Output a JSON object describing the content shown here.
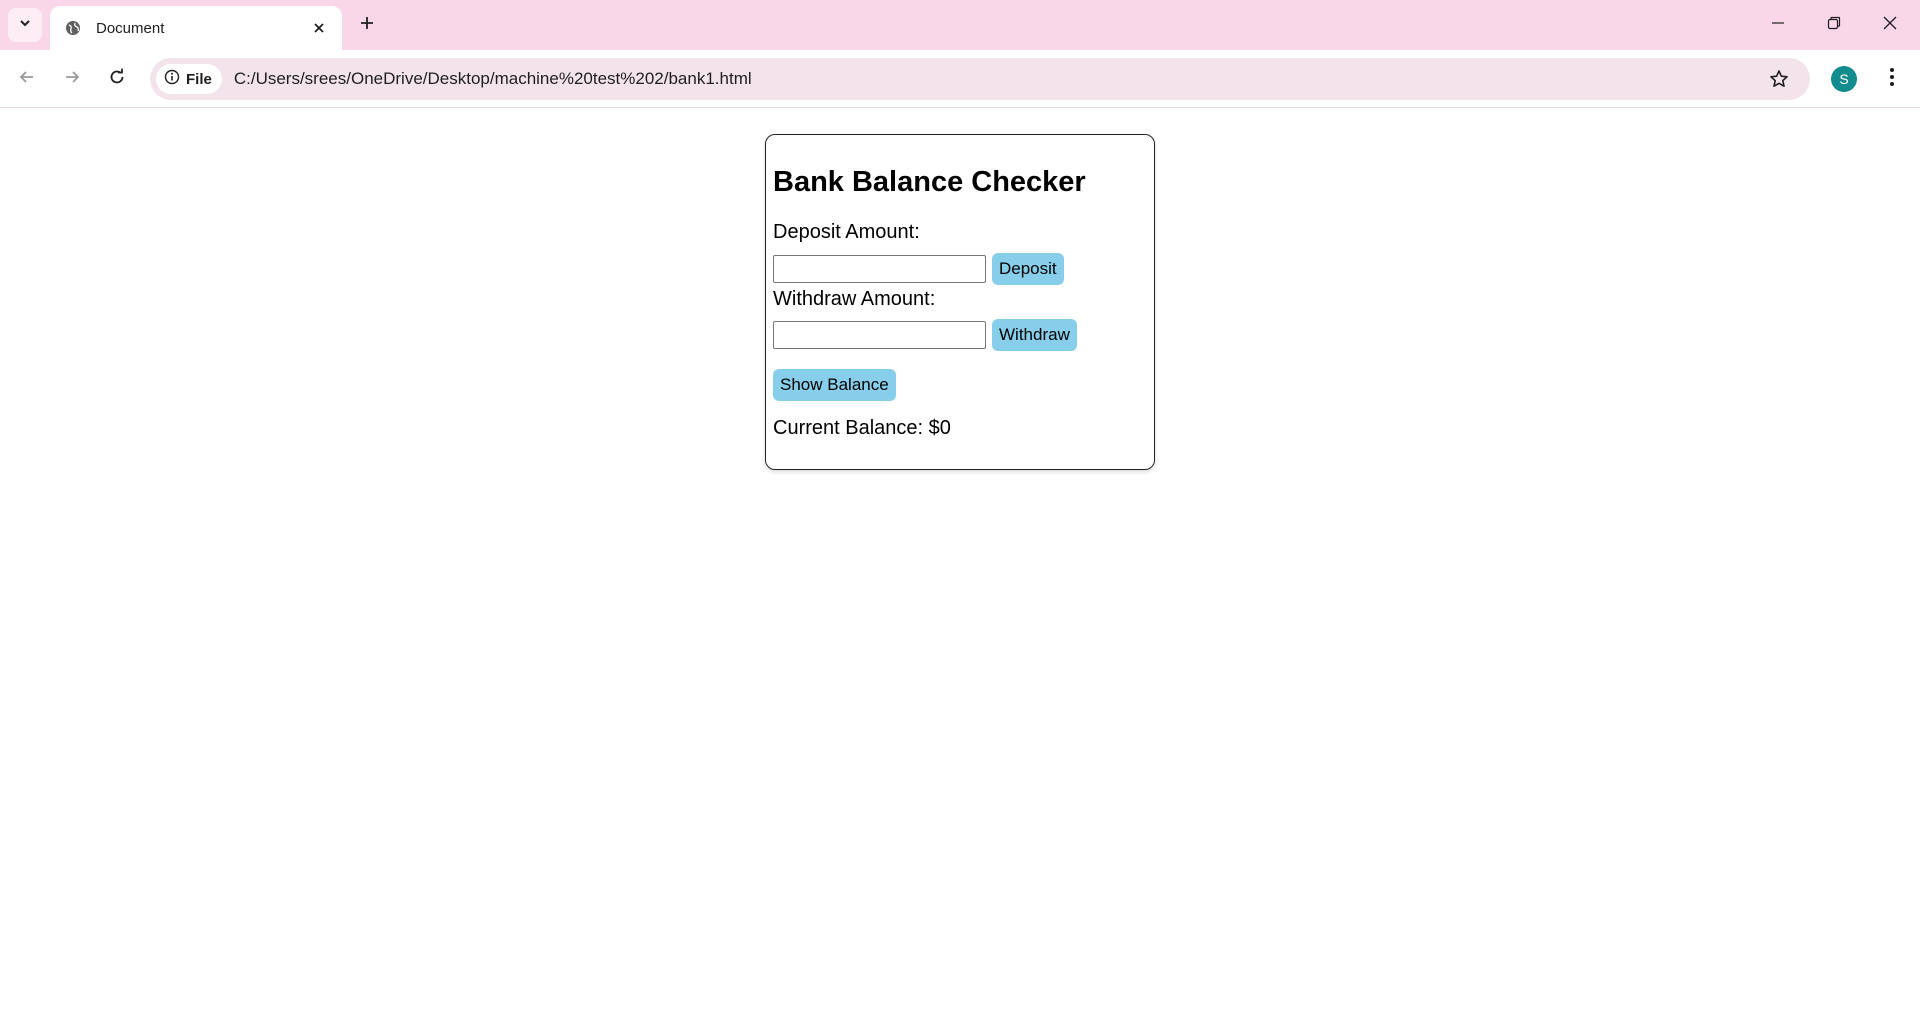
{
  "browser": {
    "tab_title": "Document",
    "chip_label": "File",
    "url": "C:/Users/srees/OneDrive/Desktop/machine%20test%202/bank1.html",
    "profile_initial": "S"
  },
  "app": {
    "title": "Bank Balance Checker",
    "deposit_label": "Deposit Amount:",
    "deposit_value": "",
    "deposit_button": "Deposit",
    "withdraw_label": "Withdraw Amount:",
    "withdraw_value": "",
    "withdraw_button": "Withdraw",
    "show_balance_button": "Show Balance",
    "current_balance": "Current Balance: $0"
  },
  "colors": {
    "tabstrip": "#f9d6e8",
    "button": "#87ceeb",
    "avatar": "#128c8c"
  }
}
